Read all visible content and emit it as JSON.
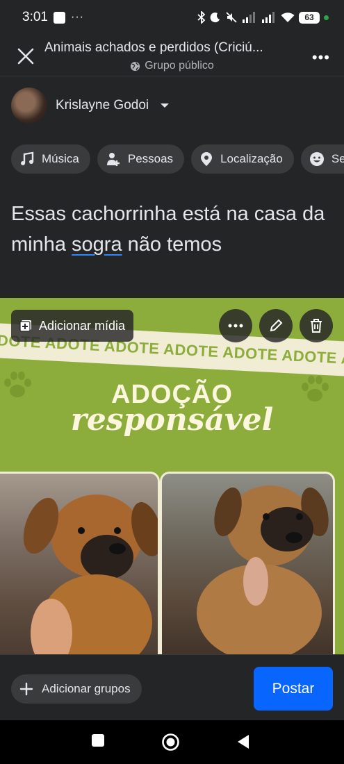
{
  "status": {
    "time": "3:01",
    "more": "···",
    "battery": "63"
  },
  "header": {
    "title": "Animais achados e perdidos (Criciú...",
    "subtitle": "Grupo público"
  },
  "author": {
    "name": "Krislayne Godoi"
  },
  "chips": [
    {
      "label": "Música",
      "icon": "music-icon"
    },
    {
      "label": "Pessoas",
      "icon": "people-icon"
    },
    {
      "label": "Localização",
      "icon": "location-icon"
    },
    {
      "label": "Se",
      "icon": "emoji-icon"
    }
  ],
  "post": {
    "text_before": "Essas cachorrinha está na casa da minha ",
    "text_underlined": "sogra",
    "text_after": " não temos"
  },
  "media": {
    "add_media_label": "Adicionar mídia",
    "stripe_text": "DOTE ADOTE ADOTE ADOTE ADOTE ADOTE ADOT",
    "headline_1": "ADOÇÃO",
    "headline_2": "responsável",
    "accent_color": "#8cad3c"
  },
  "bottom": {
    "groups_label": "Adicionar grupos",
    "post_label": "Postar",
    "post_color": "#0866ff"
  }
}
